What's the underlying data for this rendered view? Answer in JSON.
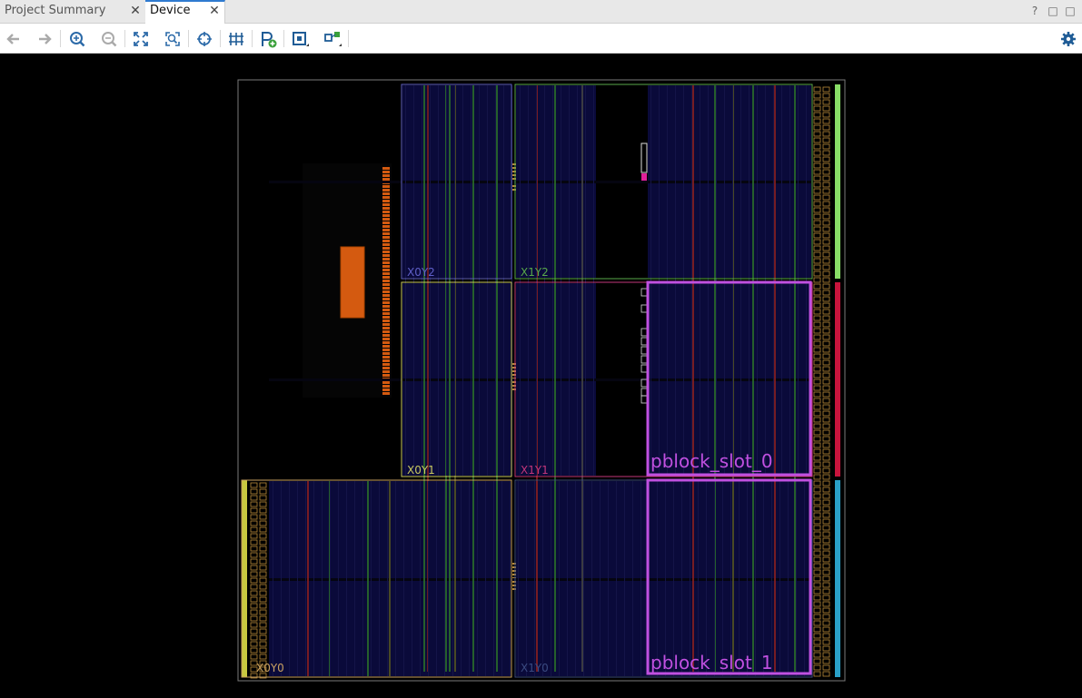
{
  "tabs": [
    {
      "label": "Project Summary",
      "active": false
    },
    {
      "label": "Device",
      "active": true
    }
  ],
  "window_controls": {
    "help": "?",
    "restore": "□",
    "maximize": "□"
  },
  "close_glyph": "✕",
  "toolbar": {
    "icons": [
      "back-arrow-icon",
      "forward-arrow-icon",
      "zoom-in-icon",
      "zoom-out-icon",
      "zoom-fit-icon",
      "zoom-selection-icon",
      "crosshair-icon",
      "routing-resources-icon",
      "add-pblock-icon",
      "draw-pblock-icon",
      "show-connections-icon"
    ],
    "settings_icon": "gear-icon"
  },
  "device": {
    "clock_regions": [
      {
        "label": "X0Y2",
        "color": "#5f5fc8"
      },
      {
        "label": "X1Y2",
        "color": "#58a84a"
      },
      {
        "label": "X0Y1",
        "color": "#c8c860"
      },
      {
        "label": "X1Y1",
        "color": "#c2367a"
      },
      {
        "label": "X0Y0",
        "color": "#c8a060"
      },
      {
        "label": "X1Y0",
        "color": "#3a4a80"
      }
    ],
    "pblocks": [
      {
        "label": "pblock_slot_0",
        "color": "#c050e0"
      },
      {
        "label": "pblock_slot_1",
        "color": "#c050e0"
      }
    ],
    "io_bank_colors": [
      "#88dd66",
      "#c8143c",
      "#2aa0c8",
      "#c8c840"
    ],
    "fabric_color": "#0a0a3a"
  }
}
